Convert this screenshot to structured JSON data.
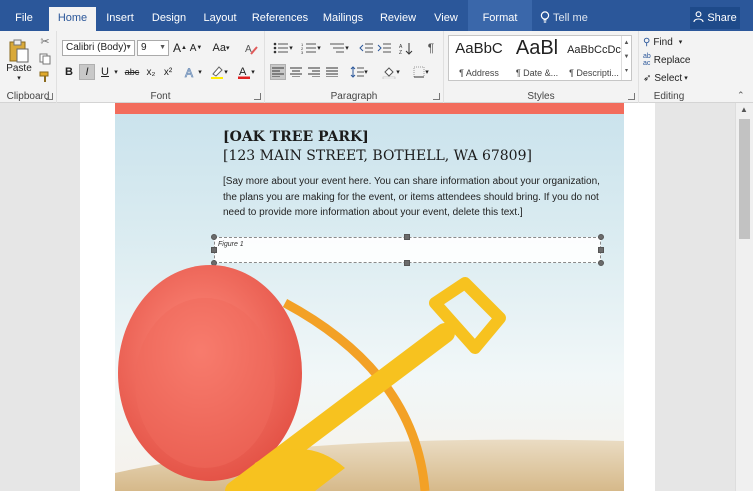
{
  "tabs": [
    {
      "label": "File",
      "active": false
    },
    {
      "label": "Home",
      "active": true
    },
    {
      "label": "Insert",
      "active": false
    },
    {
      "label": "Design",
      "active": false
    },
    {
      "label": "Layout",
      "active": false
    },
    {
      "label": "References",
      "active": false
    },
    {
      "label": "Mailings",
      "active": false
    },
    {
      "label": "Review",
      "active": false
    },
    {
      "label": "View",
      "active": false
    },
    {
      "label": "Format",
      "active": false
    }
  ],
  "tell_me": "Tell me",
  "share": "Share",
  "clipboard": {
    "paste": "Paste",
    "label": "Clipboard"
  },
  "font": {
    "name": "Calibri (Body)",
    "size": "9",
    "grow": "A",
    "shrink": "A",
    "case": "Aa",
    "label": "Font",
    "bold": "B",
    "italic": "I",
    "underline": "U",
    "strike": "abc",
    "subscript": "x₂",
    "superscript": "x²"
  },
  "paragraph": {
    "label": "Paragraph",
    "pilcrow": "¶"
  },
  "styles": {
    "label": "Styles",
    "items": [
      {
        "sample": "AaBbC",
        "name": "¶ Address"
      },
      {
        "sample": "AaBl",
        "name": "¶ Date &..."
      },
      {
        "sample": "AaBbCcDc",
        "name": "¶ Descripti..."
      }
    ]
  },
  "editing": {
    "find": "Find",
    "replace": "Replace",
    "select": "Select",
    "label": "Editing"
  },
  "document": {
    "org": "[OAK TREE PARK]",
    "address": "[123 MAIN STREET, BOTHELL, WA 67809]",
    "description": "[Say more about your event here. You can share information about your organization, the plans you are making for the event, or items attendees should bring. If you do not need to provide more information about your event, delete this text.]",
    "figure_caption": "Figure 1"
  },
  "colors": {
    "tab_bar": "#2b579a",
    "ribbon": "#f3f3f3",
    "red_bar": "#f26c5c",
    "bucket": "#f05a4e",
    "shovel": "#f7c21f",
    "sand": "#dcc49b"
  }
}
